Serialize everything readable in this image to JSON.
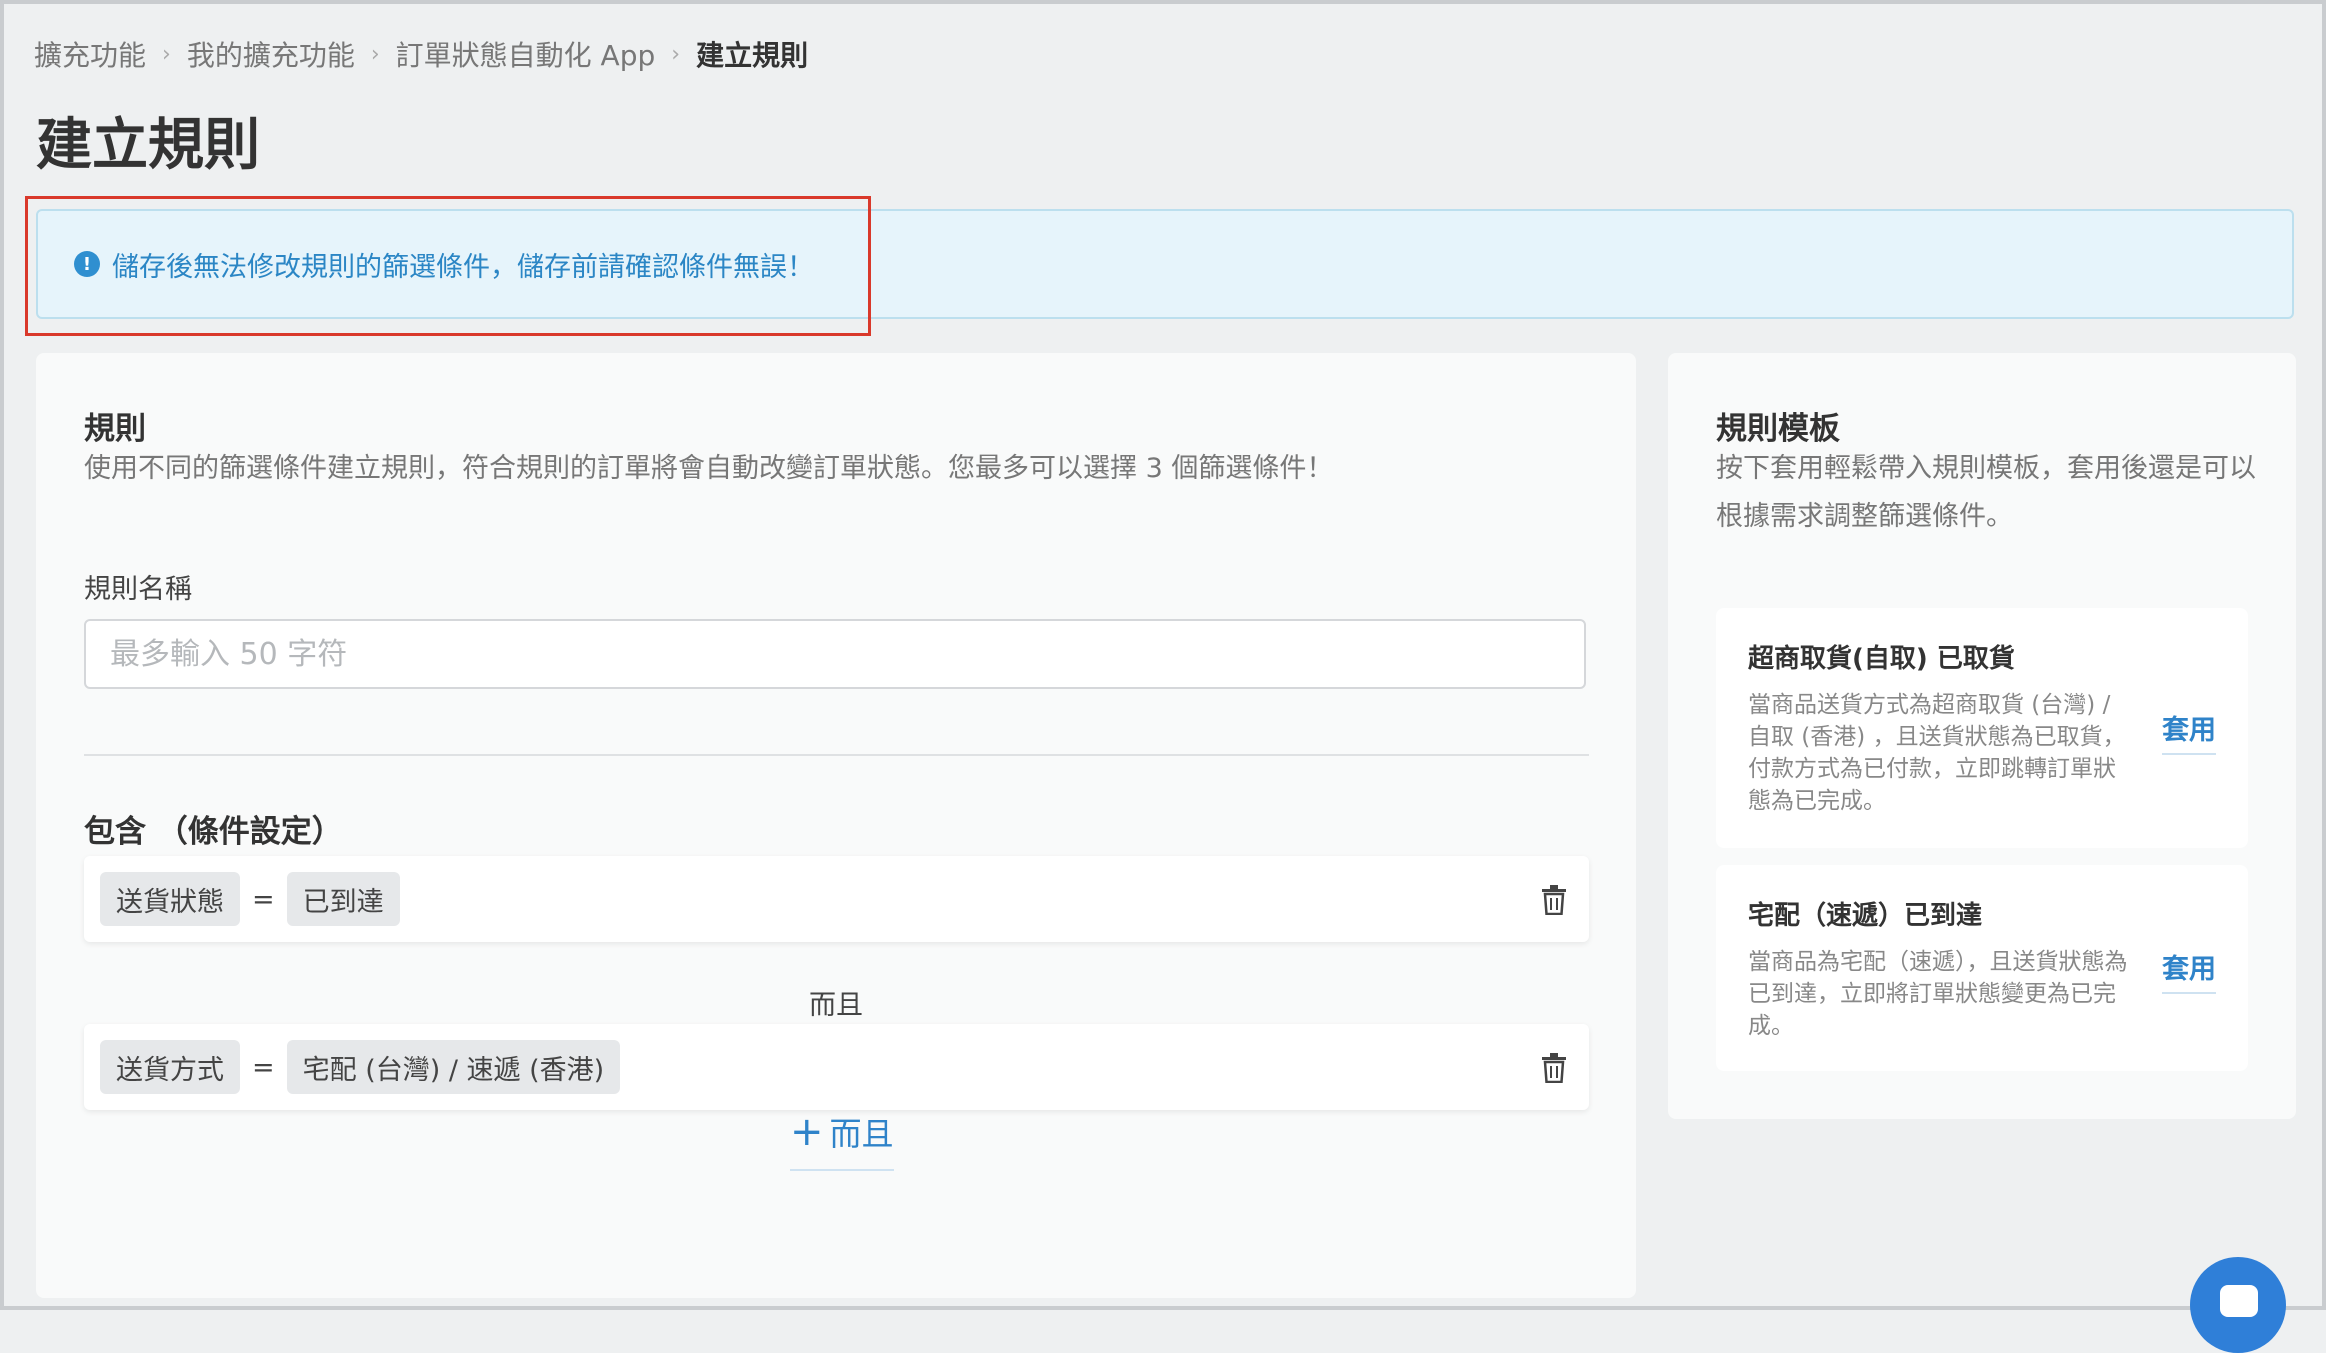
{
  "breadcrumb": {
    "items": [
      "擴充功能",
      "我的擴充功能",
      "訂單狀態自動化 App"
    ],
    "current": "建立規則"
  },
  "page_title": "建立規則",
  "alert": {
    "icon": "exclamation-circle-icon",
    "text": "儲存後無法修改規則的篩選條件，儲存前請確認條件無誤！"
  },
  "rule": {
    "title": "規則",
    "description": "使用不同的篩選條件建立規則，符合規則的訂單將會自動改變訂單狀態。您最多可以選擇 3 個篩選條件！",
    "name_label": "規則名稱",
    "name_placeholder": "最多輸入 50 字符",
    "name_value": "",
    "include_title": "包含 （條件設定）",
    "conditions": [
      {
        "field": "送貨狀態",
        "operator": "=",
        "value": "已到達"
      },
      {
        "field": "送貨方式",
        "operator": "=",
        "value": "宅配 (台灣) / 速遞 (香港)"
      }
    ],
    "and_label": "而且",
    "add_and_plus": "+",
    "add_and_label": "而且"
  },
  "templates": {
    "title": "規則模板",
    "description": "按下套用輕鬆帶入規則模板，套用後還是可以根據需求調整篩選條件。",
    "items": [
      {
        "title": "超商取貨(自取) 已取貨",
        "description": "當商品送貨方式為超商取貨 (台灣) / 自取 (香港) ，且送貨狀態為已取貨，付款方式為已付款，立即跳轉訂單狀態為已完成。",
        "apply_label": "套用"
      },
      {
        "title": "宅配（速遞）已到達",
        "description": "當商品為宅配（速遞），且送貨狀態為已到達，立即將訂單狀態變更為已完成。",
        "apply_label": "套用"
      }
    ]
  },
  "colors": {
    "accent": "#2f83c9",
    "alert_bg": "#e6f4fb",
    "highlight": "#d9392b"
  }
}
